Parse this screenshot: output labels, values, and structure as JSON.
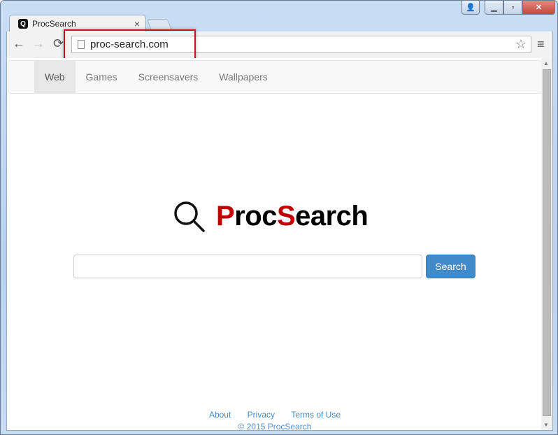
{
  "window": {
    "controls": [
      "user",
      "minimize",
      "maximize",
      "close"
    ],
    "close_color": "#c7463b"
  },
  "tab": {
    "title": "ProcSearch",
    "favicon": "Q",
    "close": "×"
  },
  "toolbar": {
    "url": "proc-search.com",
    "back": "←",
    "forward": "→",
    "reload": "⟳",
    "star": "☆",
    "menu": "≡",
    "highlight_color": "#c8141b"
  },
  "nav": {
    "items": [
      {
        "label": "Web",
        "active": true
      },
      {
        "label": "Games"
      },
      {
        "label": "Screensavers"
      },
      {
        "label": "Wallpapers"
      }
    ]
  },
  "logo": {
    "part1": "P",
    "part2": "roc",
    "part3": "S",
    "part4": "earch",
    "accent": "#bf0000"
  },
  "search": {
    "value": "",
    "placeholder": "",
    "button": "Search",
    "button_color": "#428bca"
  },
  "footer": {
    "links": [
      "About",
      "Privacy",
      "Terms of Use"
    ],
    "copyright": "© 2015 ProcSearch"
  }
}
